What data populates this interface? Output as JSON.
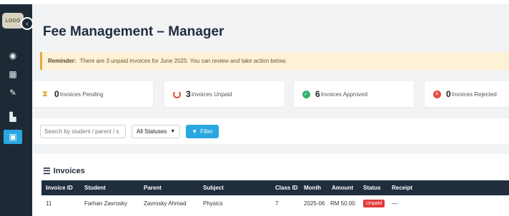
{
  "page": {
    "title": "Fee Management – Manager"
  },
  "sidebar": {
    "logo_text": "LOGO",
    "collapse_icon": "chevron-left-icon",
    "items": [
      {
        "icon": "dashboard-icon",
        "glyph": "◉",
        "active": false
      },
      {
        "icon": "calendar-icon",
        "glyph": "▦",
        "active": false
      },
      {
        "icon": "chat-icon",
        "glyph": "✎",
        "active": false
      },
      {
        "icon": "chart-icon",
        "glyph": "▙",
        "active": false
      },
      {
        "icon": "money-icon",
        "glyph": "▣",
        "active": true
      }
    ]
  },
  "reminder": {
    "label": "Reminder:",
    "text": "There are 3 unpaid invoices for June 2025.  You can review and take action below."
  },
  "stats": [
    {
      "icon": "hourglass-icon",
      "num": "0",
      "label": "Invoices Pending"
    },
    {
      "icon": "unpaid-ring-icon",
      "num": "3",
      "label": "Invoices Unpaid"
    },
    {
      "icon": "check-circle-icon",
      "num": "6",
      "label": "Invoices Approved"
    },
    {
      "icon": "x-circle-icon",
      "num": "0",
      "label": "Invoices Rejected"
    }
  ],
  "filters": {
    "search_placeholder": "Search by student / parent / s",
    "status_value": "All Statuses",
    "filter_label": "Filter"
  },
  "invoices": {
    "title": "Invoices",
    "columns": [
      "Invoice ID",
      "Student",
      "Parent",
      "Subject",
      "Class ID",
      "Month",
      "Amount",
      "Status",
      "Receipt"
    ],
    "rows": [
      {
        "id": "11",
        "student": "Farhan Zavrosky",
        "parent": "Zavrosky Ahmad",
        "subject": "Physics",
        "class_id": "7",
        "month": "2025-06",
        "amount": "RM 50.00",
        "status": "Unpaid",
        "receipt": "—"
      }
    ]
  },
  "colors": {
    "accent": "#2aa6e0",
    "sidebar": "#1d2a36",
    "danger": "#e03a3a",
    "success": "#2fb36a",
    "warning": "#e8a93c"
  }
}
